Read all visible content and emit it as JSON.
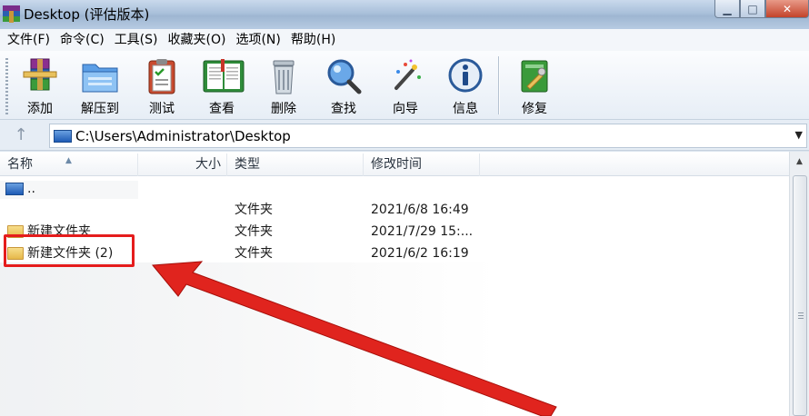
{
  "window": {
    "title": "Desktop (评估版本)",
    "controls": [
      "minimize",
      "maximize",
      "close"
    ]
  },
  "menu": [
    "文件(F)",
    "命令(C)",
    "工具(S)",
    "收藏夹(O)",
    "选项(N)",
    "帮助(H)"
  ],
  "toolbar": [
    {
      "label": "添加",
      "icon": "winrar-add-icon"
    },
    {
      "label": "解压到",
      "icon": "extract-folder-icon"
    },
    {
      "label": "测试",
      "icon": "test-clipboard-icon"
    },
    {
      "label": "查看",
      "icon": "view-book-icon"
    },
    {
      "label": "删除",
      "icon": "trash-icon"
    },
    {
      "label": "查找",
      "icon": "find-magnifier-icon"
    },
    {
      "label": "向导",
      "icon": "wizard-wand-icon"
    },
    {
      "label": "信息",
      "icon": "info-icon"
    },
    {
      "label": "修复",
      "icon": "repair-icon"
    }
  ],
  "address": {
    "path": "C:\\Users\\Administrator\\Desktop"
  },
  "columns": {
    "name": "名称",
    "size": "大小",
    "type": "类型",
    "modified": "修改时间"
  },
  "rows": [
    {
      "name": "..",
      "type": "",
      "modified": "",
      "icon": "parent-dir-icon"
    },
    {
      "name": "",
      "type": "文件夹",
      "modified": "2021/6/8 16:49",
      "icon": "folder-icon"
    },
    {
      "name": "新建文件夹",
      "type": "文件夹",
      "modified": "2021/7/29 15:...",
      "icon": "folder-icon"
    },
    {
      "name": "新建文件夹 (2)",
      "type": "文件夹",
      "modified": "2021/6/2 16:19",
      "icon": "folder-icon"
    }
  ],
  "colors": {
    "annotation": "#e51c1c",
    "titlebar": "#a9c0da"
  }
}
